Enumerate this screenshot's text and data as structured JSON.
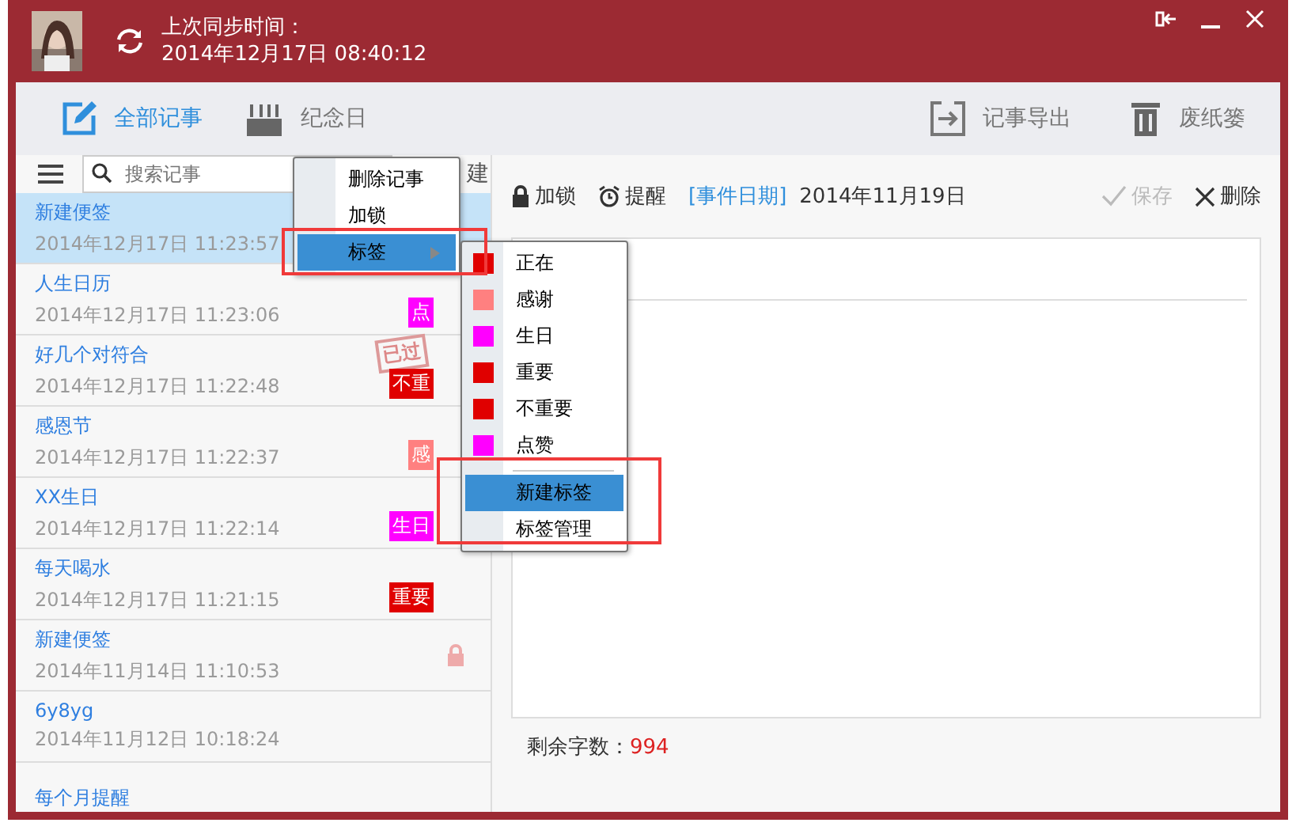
{
  "header": {
    "sync_label": "上次同步时间：",
    "sync_time": "2014年12月17日 08:40:12"
  },
  "nav": [
    {
      "label": "全部记事",
      "selected": true,
      "kind": "edit"
    },
    {
      "label": "纪念日",
      "selected": false,
      "kind": "cake"
    }
  ],
  "actions": [
    {
      "label": "记事导出",
      "kind": "export"
    },
    {
      "label": "废纸篓",
      "kind": "trash"
    }
  ],
  "search": {
    "placeholder": "搜索记事"
  },
  "new_button": "建",
  "notes": [
    {
      "title": "新建便签",
      "date": "2014年12月17日 11:23:57",
      "selected": true
    },
    {
      "title": "人生日历",
      "date": "2014年12月17日 11:23:06",
      "selected": false,
      "tag": {
        "label": "点",
        "color": "#ff00ff"
      }
    },
    {
      "title": "好几个对符合",
      "date": "2014年12月17日 11:22:48",
      "selected": false,
      "stamp": "已过",
      "tag": {
        "label": "不重",
        "color": "#e00000"
      }
    },
    {
      "title": "感恩节",
      "date": "2014年12月17日 11:22:37",
      "selected": false,
      "tag": {
        "label": "感",
        "color": "#ff8080"
      }
    },
    {
      "title": "XX生日",
      "date": "2014年12月17日 11:22:14",
      "selected": false,
      "tag": {
        "label": "生日",
        "color": "#ff00ff"
      }
    },
    {
      "title": "每天喝水",
      "date": "2014年12月17日 11:21:15",
      "selected": false,
      "tag": {
        "label": "重要",
        "color": "#e00000"
      }
    },
    {
      "title": "新建便签",
      "date": "2014年11月14日 11:10:53",
      "selected": false,
      "locked": true
    },
    {
      "title": "6y8yg",
      "date": "2014年11月12日 10:18:24",
      "selected": false
    },
    {
      "title": "每个月提醒",
      "selected": false
    }
  ],
  "editor": {
    "lock": "加锁",
    "remind": "提醒",
    "date_label": "[事件日期]",
    "date": "2014年11月19日",
    "save": "保存",
    "save_disabled": true,
    "delete": "删除",
    "remaining_label": "剩余字数：",
    "remaining": "994"
  },
  "context_menu": [
    {
      "label": "删除记事",
      "selected": false
    },
    {
      "label": "加锁",
      "selected": false
    },
    {
      "label": "标签",
      "selected": true,
      "submenu": true
    }
  ],
  "tag_menu": [
    {
      "label": "正在",
      "color": "#e00000"
    },
    {
      "label": "感谢",
      "color": "#ff8080"
    },
    {
      "label": "生日",
      "color": "#ff00ff"
    },
    {
      "label": "重要",
      "color": "#e00000"
    },
    {
      "label": "不重要",
      "color": "#e00000"
    },
    {
      "label": "点赞",
      "color": "#ff00ff"
    }
  ],
  "tag_actions": [
    {
      "label": "新建标签",
      "selected": true
    },
    {
      "label": "标签管理",
      "selected": false
    }
  ]
}
